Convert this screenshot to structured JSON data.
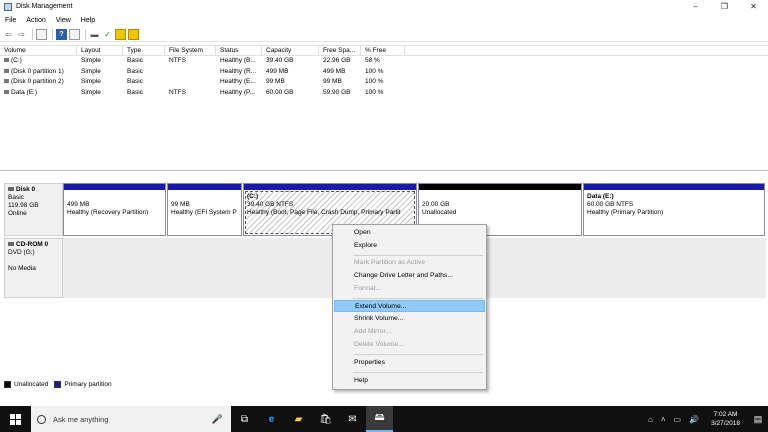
{
  "window": {
    "title": "Disk Management",
    "minimize": "–",
    "maximize": "❐",
    "close": "✕"
  },
  "menu": [
    "File",
    "Action",
    "View",
    "Help"
  ],
  "toolbar": {
    "back": "⇦",
    "forward": "⇨",
    "help": "?"
  },
  "volumes": {
    "headers": [
      "Volume",
      "Layout",
      "Type",
      "File System",
      "Status",
      "Capacity",
      "Free Spa...",
      "% Free"
    ],
    "rows": [
      [
        "(C:)",
        "Simple",
        "Basic",
        "NTFS",
        "Healthy (B...",
        "39.40 GB",
        "22.96 GB",
        "58 %"
      ],
      [
        "(Disk 0 partition 1)",
        "Simple",
        "Basic",
        "",
        "Healthy (R...",
        "499 MB",
        "499 MB",
        "100 %"
      ],
      [
        "(Disk 0 partition 2)",
        "Simple",
        "Basic",
        "",
        "Healthy (E...",
        "99 MB",
        "99 MB",
        "100 %"
      ],
      [
        "Data (E:)",
        "Simple",
        "Basic",
        "NTFS",
        "Healthy (P...",
        "60.00 GB",
        "59.90 GB",
        "100 %"
      ]
    ]
  },
  "disk0": {
    "name": "Disk 0",
    "type": "Basic",
    "size": "119.98 GB",
    "status": "Online",
    "partitions": [
      {
        "line1": "",
        "line2": "499 MB",
        "line3": "Healthy (Recovery Partition)"
      },
      {
        "line1": "",
        "line2": "99 MB",
        "line3": "Healthy (EFI System P"
      },
      {
        "line1": "(C:)",
        "line2": "39.40 GB NTFS",
        "line3": "Healthy (Boot, Page File, Crash Dump, Primary Partit"
      },
      {
        "line1": "",
        "line2": "20.00 GB",
        "line3": "Unallocated"
      },
      {
        "line1": "Data  (E:)",
        "line2": "60.00 GB NTFS",
        "line3": "Healthy (Primary Partition)"
      }
    ]
  },
  "cdrom": {
    "name": "CD-ROM 0",
    "type": "DVD (G:)",
    "status": "No Media"
  },
  "legend": {
    "unallocated": "Unallocated",
    "primary": "Primary partition"
  },
  "context_menu": {
    "items": [
      {
        "label": "Open",
        "disabled": false
      },
      {
        "label": "Explore",
        "disabled": false
      },
      {
        "label": "Mark Partition as Active",
        "disabled": true
      },
      {
        "label": "Change Drive Letter and Paths...",
        "disabled": false
      },
      {
        "label": "Format...",
        "disabled": true
      },
      {
        "label": "Extend Volume...",
        "disabled": false,
        "highlighted": true
      },
      {
        "label": "Shrink Volume...",
        "disabled": false
      },
      {
        "label": "Add Mirror...",
        "disabled": true
      },
      {
        "label": "Delete Volume...",
        "disabled": true
      },
      {
        "label": "Properties",
        "disabled": false
      },
      {
        "label": "Help",
        "disabled": false
      }
    ]
  },
  "taskbar": {
    "search_placeholder": "Ask me anything",
    "time": "7:02 AM",
    "date": "3/27/2018"
  },
  "colors": {
    "primary_partition": "#1a1aa8",
    "unallocated": "#000000",
    "highlight": "#91c9f7",
    "taskbar": "#101010"
  }
}
